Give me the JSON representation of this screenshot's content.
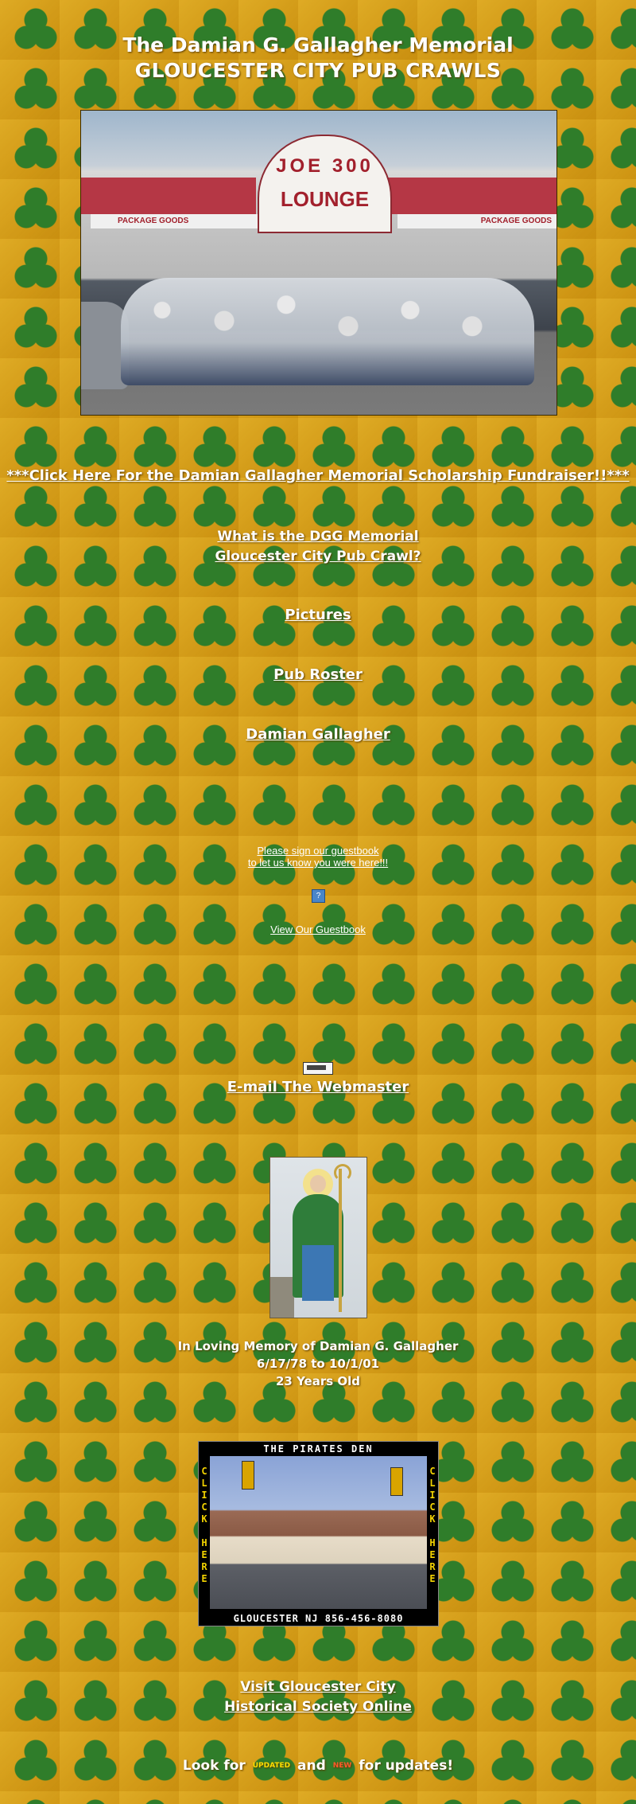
{
  "header": {
    "title_line1": "The Damian G. Gallagher Memorial",
    "title_line2": "GLOUCESTER CITY PUB CRAWLS"
  },
  "photo": {
    "sign_line1": "JOE 300",
    "sign_line2": "LOUNGE",
    "package_left": "PACKAGE GOODS",
    "package_right": "PACKAGE GOODS"
  },
  "links": {
    "scholarship": "***Click Here For the Damian Gallagher Memorial Scholarship Fundraiser!!***",
    "what_is_line1": "What is the DGG Memorial",
    "what_is_line2": "Gloucester City Pub Crawl?",
    "pictures": "Pictures",
    "pub_roster": "Pub Roster",
    "damian": "Damian Gallagher"
  },
  "guestbook": {
    "sign_line1": "Please sign our guestbook",
    "sign_line2": "to let us know you were here!!!",
    "icon": "?",
    "view": "View Our Guestbook"
  },
  "email": {
    "label": "E-mail The Webmaster"
  },
  "memory": {
    "line1": "In Loving Memory of Damian G. Gallagher",
    "line2": "6/17/78 to 10/1/01",
    "line3": "23 Years Old"
  },
  "pirates_ad": {
    "top": "THE PIRATES DEN",
    "side_left": "CLICK HERE",
    "side_right": "CLICK HERE",
    "bottom": "GLOUCESTER NJ 856-456-8080"
  },
  "visit": {
    "line1": "Visit Gloucester City",
    "line2": "Historical Society Online"
  },
  "footer": {
    "look_for": "Look for",
    "updated_badge": "UPDATED",
    "and": "and",
    "new_badge": "NEW",
    "for_updates": "for updates!"
  }
}
